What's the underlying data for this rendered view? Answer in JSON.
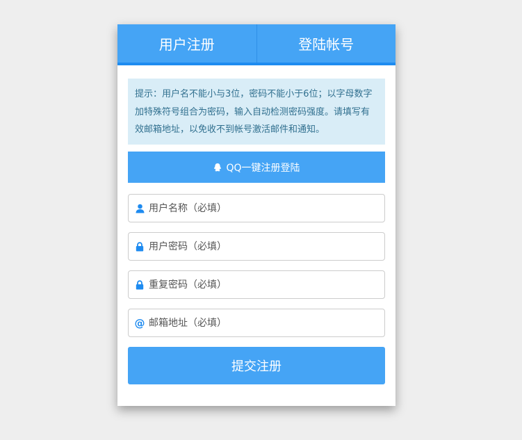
{
  "tabs": {
    "register": "用户注册",
    "login": "登陆帐号"
  },
  "notice": {
    "text": "提示：用户名不能小与3位，密码不能小于6位；以字母数字加特殊符号组合为密码，输入自动检测密码强度。请填写有效邮箱地址，以免收不到帐号激活邮件和通知。"
  },
  "qq_login": {
    "icon": "qq-penguin-icon",
    "label": "QQ一键注册登陆"
  },
  "form": {
    "username": {
      "icon": "user-icon",
      "placeholder": "用户名称（必填）"
    },
    "password": {
      "icon": "lock-icon",
      "placeholder": "用户密码（必填）"
    },
    "confirm_password": {
      "icon": "lock-icon",
      "placeholder": "重复密码（必填）"
    },
    "email": {
      "icon": "at-icon",
      "placeholder": "邮箱地址（必填）"
    }
  },
  "submit": {
    "label": "提交注册"
  },
  "colors": {
    "accent": "#45a4f5",
    "accent_dark": "#1e8bf0",
    "notice_bg": "#d9edf7",
    "notice_text": "#31708f",
    "page_bg": "#eeeeee"
  }
}
